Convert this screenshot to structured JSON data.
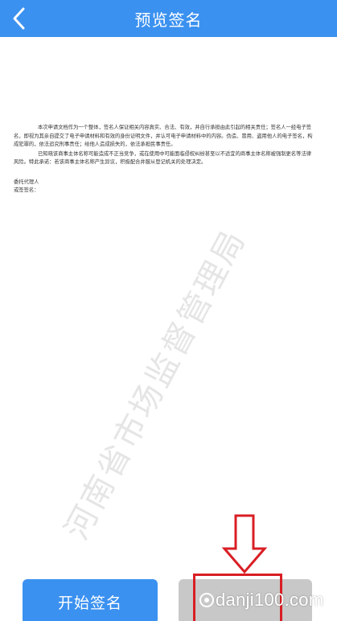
{
  "header": {
    "title": "预览签名"
  },
  "document": {
    "paragraphs": [
      "本次申请文档作为一个整体，签名人保证相关内容真实、合法、有效，并自行承担由此引起的相关责任；签名人一经电子签名，即视为其亲自提交了电子申请材料和有效的身份证明文件，并认可电子申请材料中的内容。伪造、冒用、盗用他人的电子签名，构成犯罪的，依法追究刑事责任；给他人造成损失的，依法承担民事责任。",
      "已知晓该商事主体名称可能造成不正当竞争，或在使用中可能面临侵权纠纷甚至以不适宜的商事主体名称被强制更名等法律风险。特此承诺：若该商事主体名称产生异议，积极配合并服从登记机关的处理决定。"
    ],
    "sign_label_1": "委托代理人",
    "sign_label_2": "或签签名："
  },
  "watermark_text": "河南省市场监督管理局",
  "buttons": {
    "start_sign": "开始签名"
  },
  "site_watermark": "danji100.com",
  "colors": {
    "primary": "#3b91f0",
    "disabled": "#c8c8c8",
    "highlight": "#d91e24"
  }
}
